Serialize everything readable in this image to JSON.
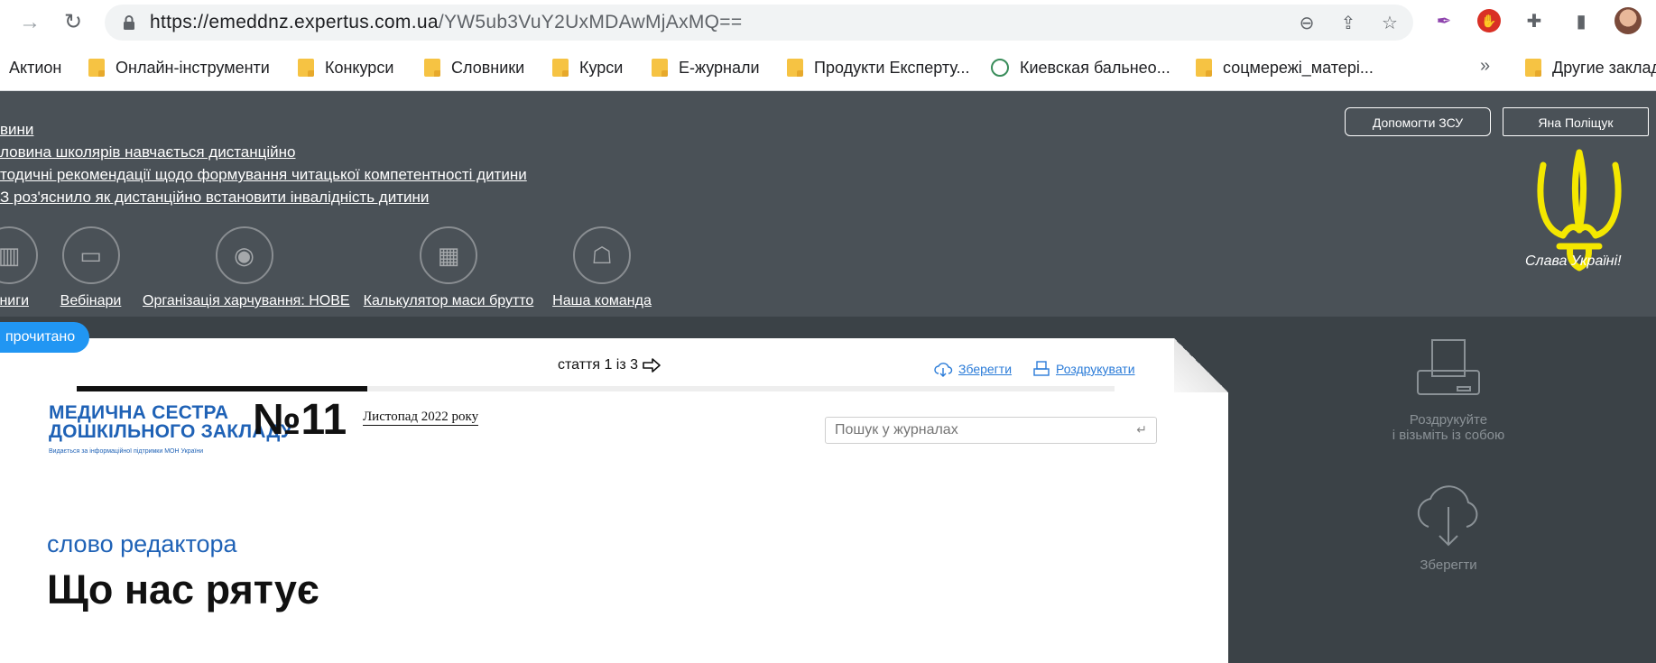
{
  "browser": {
    "url_host": "https://emeddnz.expertus.com.ua",
    "url_path": "/YW5ub3VuY2UxMDAwMjAxMQ==",
    "omnibox_icons": [
      "zoom-out-icon",
      "share-icon",
      "star-icon"
    ],
    "extension_icons": [
      "feather-icon",
      "stop-icon",
      "puzzle-icon",
      "sidepanel-icon",
      "avatar"
    ]
  },
  "bookmarks": [
    {
      "label": "Актион",
      "icon": "none"
    },
    {
      "label": "Онлайн-інструменти",
      "icon": "folder"
    },
    {
      "label": "Конкурси",
      "icon": "folder"
    },
    {
      "label": "Словники",
      "icon": "folder"
    },
    {
      "label": "Курси",
      "icon": "folder"
    },
    {
      "label": "Е-журнали",
      "icon": "folder"
    },
    {
      "label": "Продукти Експерту...",
      "icon": "folder"
    },
    {
      "label": "Киевская бальнео...",
      "icon": "globe"
    },
    {
      "label": "соцмережі_матері...",
      "icon": "folder"
    },
    {
      "label": "Другие заклад",
      "icon": "folder"
    }
  ],
  "bookmarks_more": "»",
  "header": {
    "news": [
      "вини",
      "ловина школярів навчається дистанційно",
      "тодичні рекомендації щодо формування читацької компетентності дитини",
      "З роз'яснило як дистанційно встановити інвалідність дитини"
    ],
    "help_button": "Допомогти ЗСУ",
    "user_button": "Яна Поліщук",
    "nav": [
      {
        "label": "ниги",
        "icon": "book-icon"
      },
      {
        "label": "Вебінари",
        "icon": "monitor-icon"
      },
      {
        "label": "Організація харчування: НОВЕ",
        "icon": "plate-icon"
      },
      {
        "label": "Калькулятор маси брутто",
        "icon": "calculator-icon"
      },
      {
        "label": "Наша команда",
        "icon": "team-icon"
      }
    ],
    "slogan": "Слава Україні!"
  },
  "article": {
    "read_badge": "прочитано",
    "counter": "стаття 1 із 3",
    "progress": 0.28,
    "save": "Зберегти",
    "print": "Роздрукувати",
    "journal_line1": "МЕДИЧНА СЕСТРА",
    "journal_line2": "ДОШКІЛЬНОГО ЗАКЛАДУ",
    "journal_tagline": "Видається за інформаційної підтримки МОН України",
    "issue": "№11",
    "date": "Листопад 2022 року",
    "search_placeholder": "Пошук у журналах",
    "rubric": "слово редактора",
    "title": "Що нас рятує"
  },
  "sidebar": {
    "print_line1": "Роздрукуйте",
    "print_line2": "і візьміть із собою",
    "save": "Зберегти"
  },
  "colors": {
    "header_bg": "#4a5157",
    "content_bg": "#3b4247",
    "accent_blue": "#2196f3",
    "brand_blue": "#1f62b6",
    "trident_yellow": "#f4e700"
  }
}
